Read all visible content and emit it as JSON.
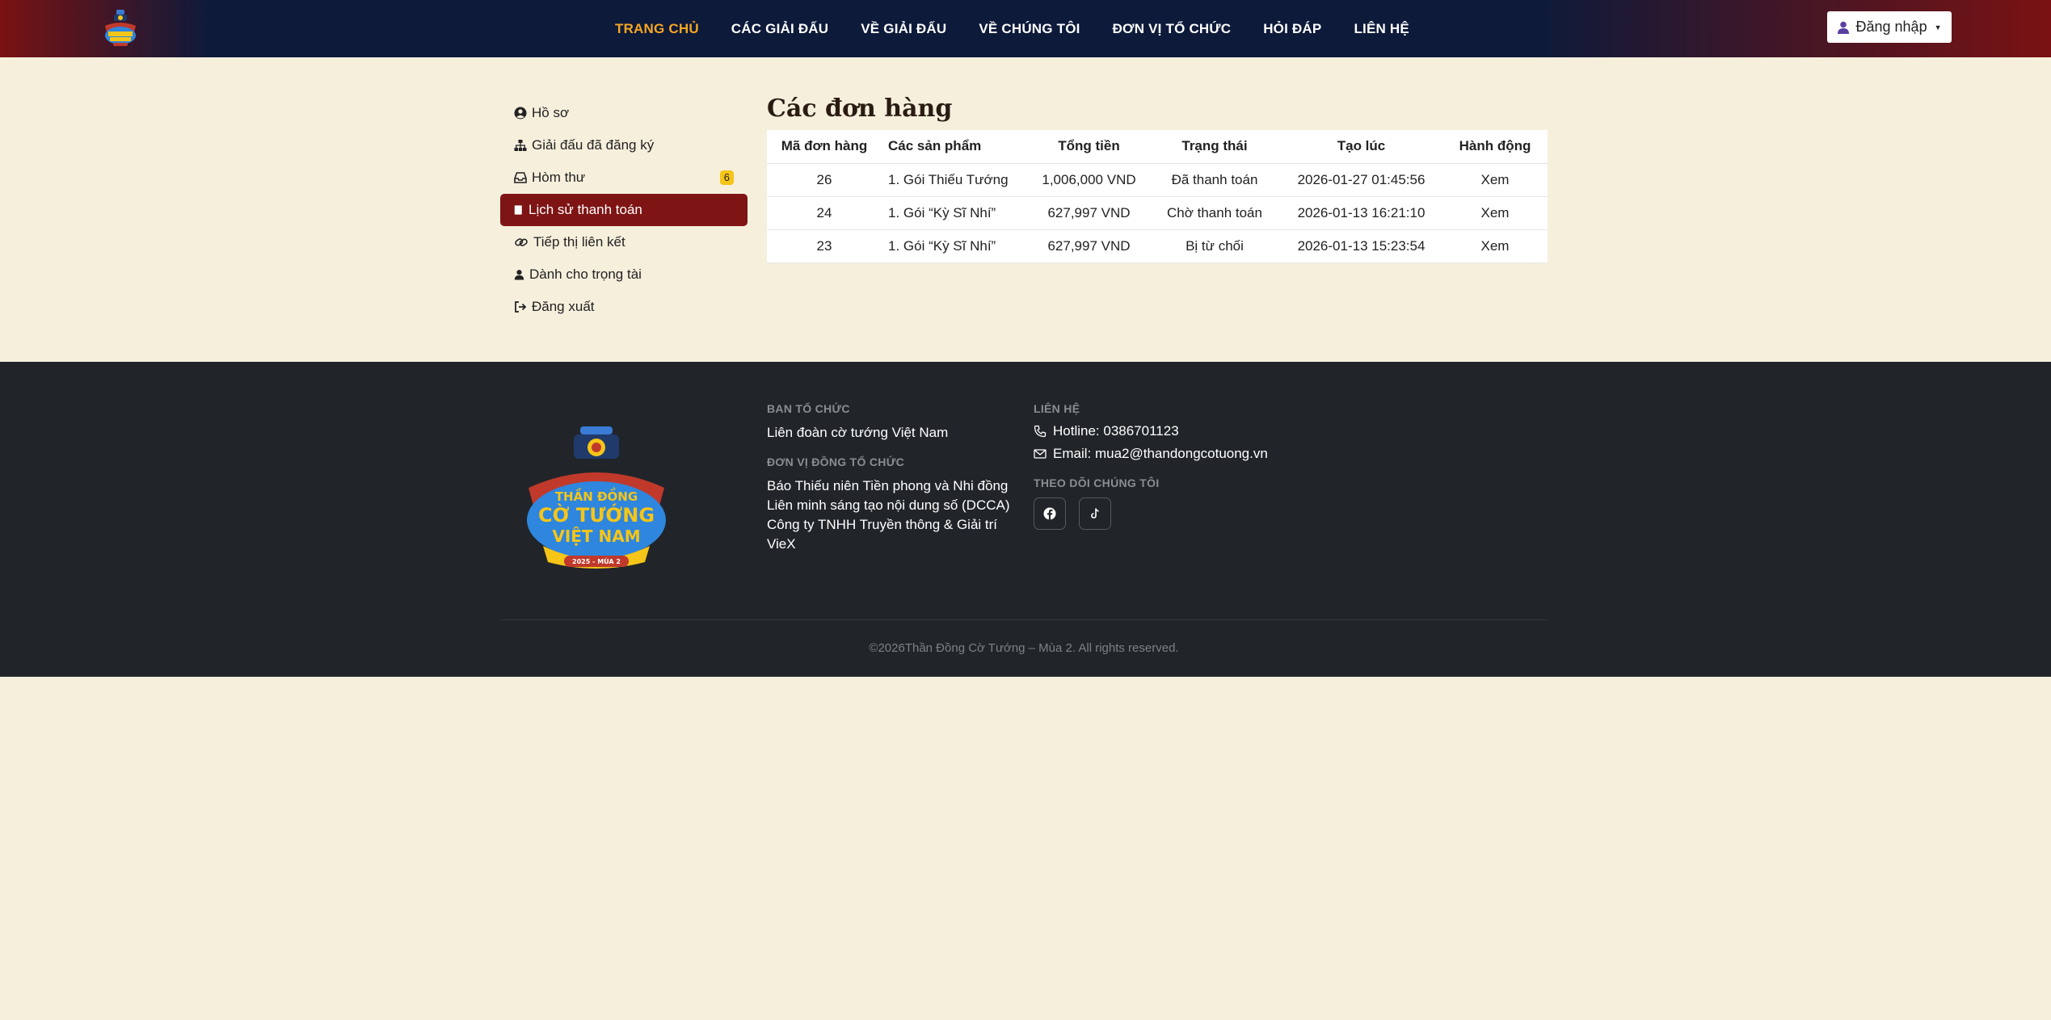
{
  "nav": {
    "items": [
      {
        "label": "TRANG CHỦ",
        "active": true
      },
      {
        "label": "CÁC GIẢI ĐẤU"
      },
      {
        "label": "VỀ GIẢI ĐẤU"
      },
      {
        "label": "VỀ CHÚNG TÔI"
      },
      {
        "label": "ĐƠN VỊ TỔ CHỨC"
      },
      {
        "label": "HỎI ĐÁP"
      },
      {
        "label": "LIÊN HỆ"
      }
    ],
    "login_label": "Đăng nhập"
  },
  "sidebar": {
    "items": [
      {
        "label": "Hồ sơ",
        "icon": "user-circle-icon"
      },
      {
        "label": "Giải đấu đã đăng ký",
        "icon": "sitemap-icon"
      },
      {
        "label": "Hòm thư",
        "icon": "inbox-icon",
        "badge": "6"
      },
      {
        "label": "Lịch sử thanh toán",
        "icon": "receipt-icon",
        "active": true
      },
      {
        "label": "Tiếp thị liên kết",
        "icon": "link-icon"
      },
      {
        "label": "Dành cho trọng tài",
        "icon": "user-tie-icon"
      },
      {
        "label": "Đăng xuất",
        "icon": "sign-out-icon"
      }
    ]
  },
  "main": {
    "title": "Các đơn hàng",
    "columns": [
      "Mã đơn hàng",
      "Các sản phẩm",
      "Tổng tiền",
      "Trạng thái",
      "Tạo lúc",
      "Hành động"
    ],
    "rows": [
      {
        "id": "26",
        "product": "1. Gói Thiếu Tướng",
        "total": "1,006,000 VND",
        "status": "Đã thanh toán",
        "created": "2026-01-27 01:45:56",
        "action": "Xem"
      },
      {
        "id": "24",
        "product": "1. Gói “Kỳ Sĩ Nhí”",
        "total": "627,997 VND",
        "status": "Chờ thanh toán",
        "created": "2026-01-13 16:21:10",
        "action": "Xem"
      },
      {
        "id": "23",
        "product": "1. Gói “Kỳ Sĩ Nhí”",
        "total": "627,997 VND",
        "status": "Bị từ chối",
        "created": "2026-01-13 15:23:54",
        "action": "Xem"
      }
    ]
  },
  "footer": {
    "logo_text": {
      "line1": "THẦN ĐỒNG",
      "line2": "CỜ TƯỚNG",
      "line3": "VIỆT NAM",
      "season": "2025 - MÙA 2"
    },
    "organizer_heading": "BAN TỔ CHỨC",
    "organizer": "Liên đoàn cờ tướng Việt Nam",
    "co_organizer_heading": "ĐƠN VỊ ĐỒNG TỔ CHỨC",
    "co_organizers": [
      "Báo Thiếu niên Tiền phong và Nhi đồng",
      "Liên minh sáng tạo nội dung số (DCCA)",
      "Công ty TNHH Truyền thông & Giải trí",
      "VieX"
    ],
    "contact_heading": "LIÊN HỆ",
    "hotline": "Hotline: 0386701123",
    "email": "Email: mua2@thandongcotuong.vn",
    "follow_heading": "THEO DÕI CHÚNG TÔI",
    "copyright": "©2026Thần Đồng Cờ Tướng – Mùa 2. All rights reserved."
  },
  "colors": {
    "accent": "#7e1414",
    "nav_active": "#f5a623",
    "header_bg": "#0d1a3a",
    "footer_bg": "#212529",
    "page_bg": "#f6efdc"
  }
}
